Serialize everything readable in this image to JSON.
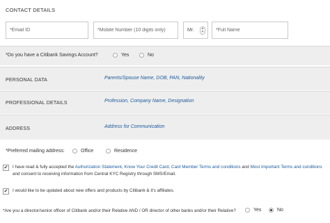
{
  "contact": {
    "title": "CONTACT DETAILS",
    "email_placeholder": "*Email ID",
    "mobile_placeholder": "*Mobile Number (10 digits only)",
    "salutation": "Mr.",
    "fullname_placeholder": "*Full Name"
  },
  "savings": {
    "question": "*Do you have a Citibank Savings Account?",
    "yes": "Yes",
    "no": "No"
  },
  "sections": {
    "personal": {
      "label": "PERSONAL DATA",
      "sub": "Parents/Spouse Name, DOB, PAN, Nationality"
    },
    "professional": {
      "label": "PROFESSIONAL DETAILS",
      "sub": "Profession, Company Name, Designation"
    },
    "address": {
      "label": "ADDRESS",
      "sub": "Address for Communication"
    }
  },
  "mailing": {
    "question": "*Preferred mailing address:",
    "office": "Office",
    "residence": "Residence"
  },
  "consent1": {
    "prefix": "I have read & fully accepted the ",
    "link1": "Authorization Statement",
    "sep1": ", ",
    "link2": "Know Your Credit Card",
    "sep2": ", ",
    "link3": "Card Member Terms and conditions",
    "sep3": " and ",
    "link4": "Most Important Terms and conditions",
    "line2": "and consent to receiving information from Central KYC Registry through SMS/Email."
  },
  "consent2": {
    "text": "I would like to be updated about new offers and products by Citibank & it's affiliates."
  },
  "director": {
    "question": "*Are you a director/senior officer of Citibank and/or their Relative AND / OR director of other banks and/or their Relative?",
    "yes": "Yes",
    "no": "No"
  }
}
